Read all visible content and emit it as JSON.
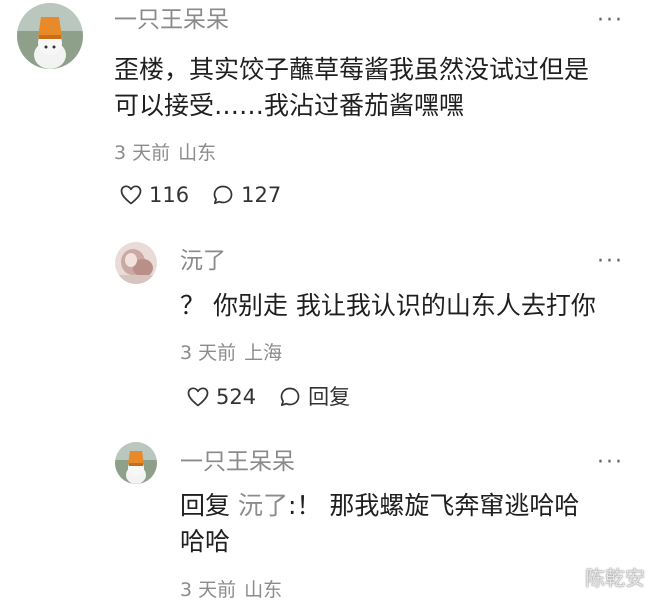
{
  "comment": {
    "username": "一只王呆呆",
    "content_line1": "歪楼，其实饺子蘸草莓酱我虽然没试过但是",
    "content_line2": "可以接受……我沾过番茄酱嘿嘿",
    "time": "3 天前",
    "location": "山东",
    "like_count": "116",
    "reply_count": "127",
    "more_label": "···"
  },
  "reply1": {
    "username": "沅了",
    "content": "？ 你别走 我让我认识的山东人去打你",
    "time": "3 天前",
    "location": "上海",
    "like_count": "524",
    "reply_label": "回复",
    "more_label": "···"
  },
  "reply2": {
    "username": "一只王呆呆",
    "reply_prefix": "回复",
    "mention": "沅了",
    "content_line1_rest": ":！ 那我螺旋飞奔窜逃哈哈",
    "content_line2": "哈哈",
    "time": "3 天前",
    "location": "山东",
    "more_label": "···"
  },
  "watermark": "陈乾安",
  "icons": {
    "like": "heart-icon",
    "comment": "speech-bubble-icon",
    "more": "more-dots-icon"
  },
  "colors": {
    "text": "#1f1f1f",
    "muted": "#8c8c8c",
    "avatar_hat": "#e8892a"
  }
}
